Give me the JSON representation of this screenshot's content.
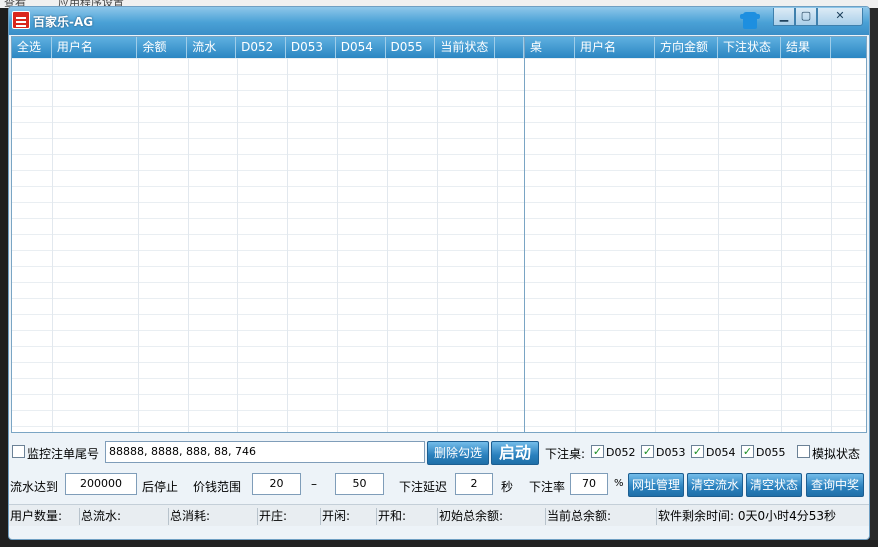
{
  "background": {
    "left_text": "查看",
    "tab_text": "应用程序设置"
  },
  "window": {
    "title": "百家乐-AG"
  },
  "icons": {
    "app": "app-icon",
    "skin": "shirt-icon",
    "minimize": "minimize-icon",
    "maximize": "maximize-icon",
    "close": "close-icon"
  },
  "left_table": {
    "columns": [
      "全选",
      "用户名",
      "余额",
      "流水",
      "D052",
      "D053",
      "D054",
      "D055",
      "当前状态",
      ""
    ]
  },
  "right_table": {
    "columns": [
      "桌",
      "用户名",
      "方向金额",
      "下注状态",
      "结果",
      ""
    ]
  },
  "controls": {
    "monitor_label": "监控注单尾号",
    "tail_numbers": "88888, 8888, 888, 88, 746",
    "delete_checked": "删除勾选",
    "start": "启动",
    "bet_table_label": "下注桌:",
    "tables": [
      {
        "label": "D052",
        "checked": true
      },
      {
        "label": "D053",
        "checked": true
      },
      {
        "label": "D054",
        "checked": true
      },
      {
        "label": "D055",
        "checked": true
      }
    ],
    "simulate_label": "模拟状态",
    "flow_reach_label": "流水达到",
    "flow_value": "200000",
    "stop_after_label": "后停止",
    "price_range_label": "价钱范围",
    "price_min": "20",
    "price_dash": "–",
    "price_max": "50",
    "delay_label": "下注延迟",
    "delay_value": "2",
    "seconds_label": "秒",
    "rate_label": "下注率",
    "rate_value": "70",
    "percent_label": "%",
    "buttons": [
      "网址管理",
      "清空流水",
      "清空状态",
      "查询中奖"
    ]
  },
  "status": {
    "user_count": "用户数量:",
    "total_flow": "总流水:",
    "total_consume": "总消耗:",
    "kaizhuang": "开庄:",
    "kaixian": "开闲:",
    "kaihe": "开和:",
    "initial_total": "初始总余额:",
    "current_total": "当前总余额:",
    "remaining_time": "软件剩余时间: 0天0小时4分53秒"
  }
}
